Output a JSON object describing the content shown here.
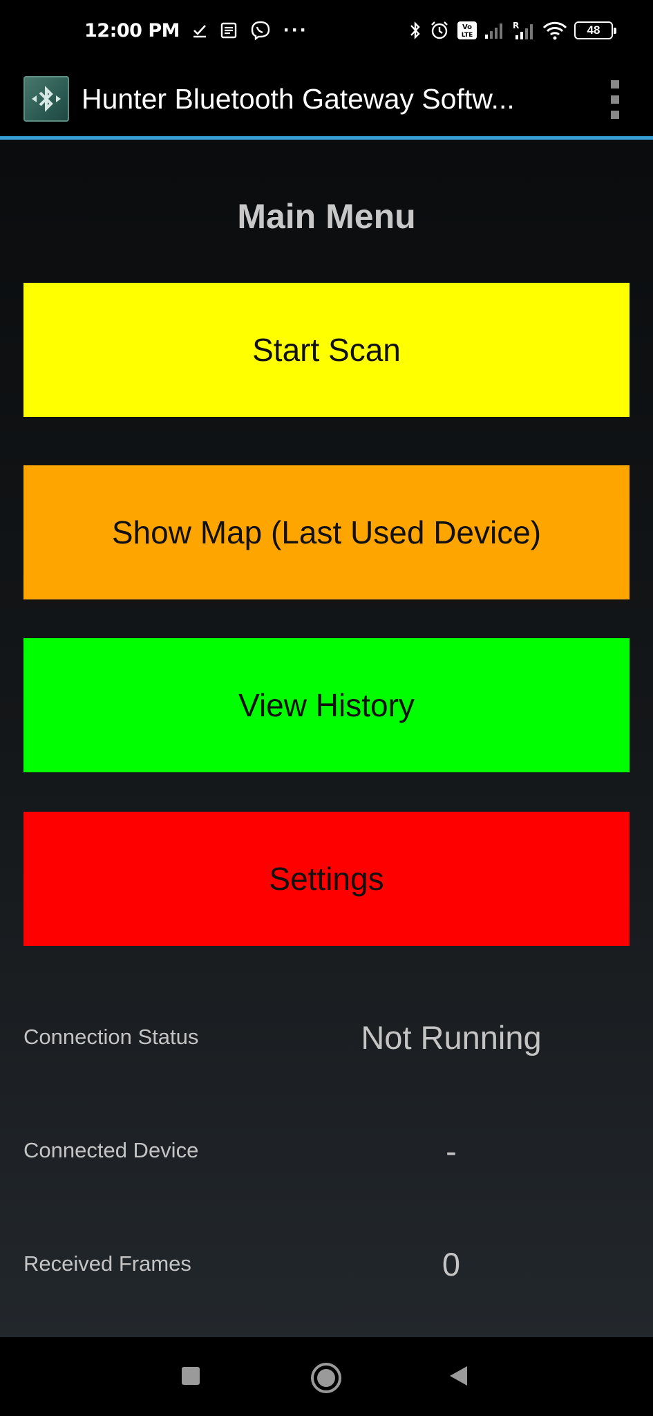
{
  "status_bar": {
    "time": "12:00 PM",
    "more_label": "···",
    "battery_level": "48",
    "icons": [
      "check-icon",
      "news-icon",
      "viber-icon",
      "bluetooth-icon",
      "alarm-icon",
      "volte-icon",
      "signal-icon",
      "roaming-signal-icon",
      "wifi-icon",
      "battery-icon"
    ]
  },
  "action_bar": {
    "title": "Hunter Bluetooth Gateway Softw..."
  },
  "main": {
    "title": "Main Menu",
    "buttons": [
      {
        "label": "Start Scan",
        "color": "#ffff00"
      },
      {
        "label": "Show Map (Last Used Device)",
        "color": "#ffa500"
      },
      {
        "label": "View History",
        "color": "#00ff00"
      },
      {
        "label": "Settings",
        "color": "#ff0000"
      }
    ],
    "info": [
      {
        "label": "Connection Status",
        "value": "Not Running"
      },
      {
        "label": "Connected Device",
        "value": "-"
      },
      {
        "label": "Received Frames",
        "value": "0"
      }
    ]
  },
  "colors": {
    "accent_divider": "#3a9ed9",
    "text_muted": "#c4c4c4"
  }
}
